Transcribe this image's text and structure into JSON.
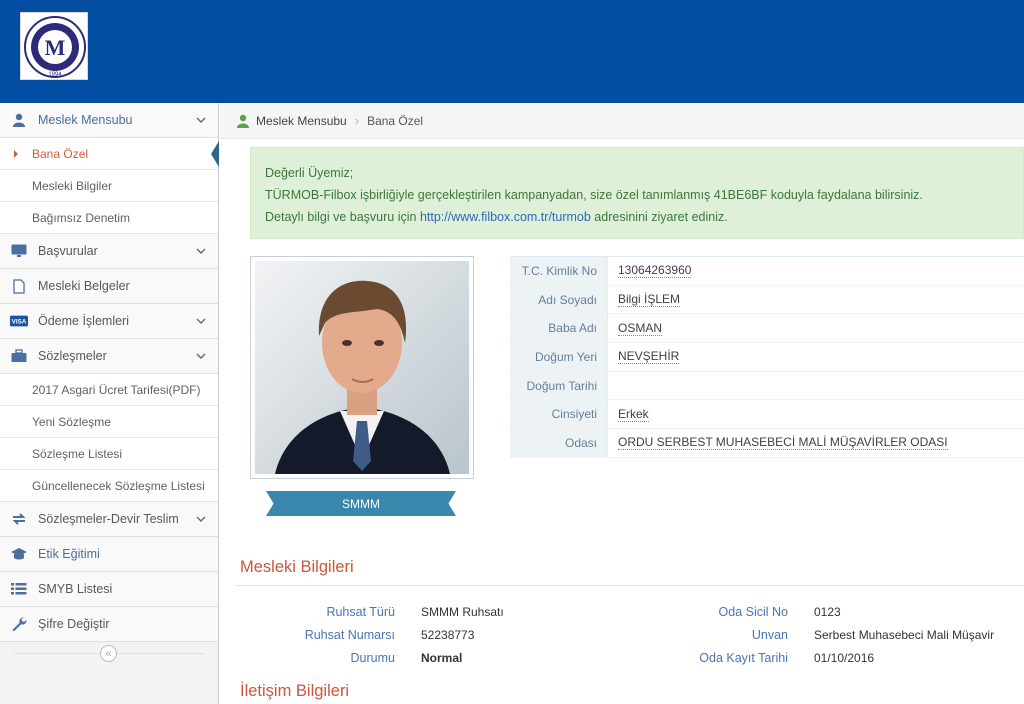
{
  "logo": {
    "name": "oda-logo",
    "letter": "M",
    "caption": "1994"
  },
  "sidebar": {
    "items": [
      {
        "label": "Meslek Mensubu",
        "icon": "user-icon",
        "chevron": true
      },
      {
        "label": "Başvurular",
        "icon": "desktop-icon",
        "chevron": true
      },
      {
        "label": "Mesleki Belgeler",
        "icon": "file-icon",
        "chevron": false
      },
      {
        "label": "Ödeme İşlemleri",
        "icon": "visa-icon",
        "chevron": true
      },
      {
        "label": "Sözleşmeler",
        "icon": "briefcase-icon",
        "chevron": true
      },
      {
        "label": "Sözleşmeler-Devir Teslim",
        "icon": "exchange-icon",
        "chevron": true
      },
      {
        "label": "Etik Eğitimi",
        "icon": "graduation-cap-icon",
        "chevron": false
      },
      {
        "label": "SMYB Listesi",
        "icon": "list-icon",
        "chevron": false
      },
      {
        "label": "Şifre Değiştir",
        "icon": "wrench-icon",
        "chevron": false
      }
    ],
    "meslek_sub": [
      {
        "label": "Bana Özel"
      },
      {
        "label": "Mesleki Bilgiler"
      },
      {
        "label": "Bağımsız Denetim"
      }
    ],
    "sozlesme_sub": [
      {
        "label": "2017 Asgari Ücret Tarifesi(PDF)"
      },
      {
        "label": "Yeni Sözleşme"
      },
      {
        "label": "Sözleşme Listesi"
      },
      {
        "label": "Güncellenecek Sözleşme Listesi"
      }
    ],
    "collapse_glyph": "«"
  },
  "breadcrumb": {
    "home": "Meslek Mensubu",
    "separator": "›",
    "current": "Bana Özel"
  },
  "alert": {
    "line1": "Değerli Üyemiz;",
    "line2": "TÜRMOB-Filbox işbirliğiyle gerçekleştirilen kampanyadan, size özel tanımlanmış 41BE6BF koduyla faydalana bilirsiniz.",
    "line3_before": "Detaylı bilgi ve başvuru için ",
    "link": "http://www.filbox.com.tr/turmob",
    "line3_after": " adresinini ziyaret ediniz."
  },
  "profile": {
    "badge": "SMMM",
    "rows": [
      {
        "name": "T.C. Kimlik No",
        "value": "13064263960"
      },
      {
        "name": "Adı Soyadı",
        "value": "Bilgi İŞLEM"
      },
      {
        "name": "Baba Adı",
        "value": "OSMAN"
      },
      {
        "name": "Doğum Yeri",
        "value": "NEVŞEHİR"
      },
      {
        "name": "Doğum Tarihi",
        "value": ""
      },
      {
        "name": "Cinsiyeti",
        "value": "Erkek"
      },
      {
        "name": "Odası",
        "value": "ORDU SERBEST MUHASEBECİ MALİ MÜŞAVİRLER ODASI"
      }
    ]
  },
  "mesleki": {
    "title": "Mesleki Bilgileri",
    "left": [
      {
        "label": "Ruhsat Türü",
        "value": "SMMM Ruhsatı"
      },
      {
        "label": "Ruhsat Numarsı",
        "value": "52238773"
      },
      {
        "label": "Durumu",
        "value": "Normal"
      }
    ],
    "right": [
      {
        "label": "Oda Sicil No",
        "value": "0123"
      },
      {
        "label": "Unvan",
        "value": "Serbest Muhasebeci Mali Müşavir"
      },
      {
        "label": "Oda Kayıt Tarihi",
        "value": "01/10/2016"
      }
    ]
  },
  "iletisim": {
    "title": "İletişim Bilgileri"
  },
  "colors": {
    "navbar": "#034ea2",
    "accent_orange": "#c9573a",
    "label_blue": "#4a75b0",
    "alert_bg": "#dff0d8",
    "badge": "#3a87ad"
  }
}
